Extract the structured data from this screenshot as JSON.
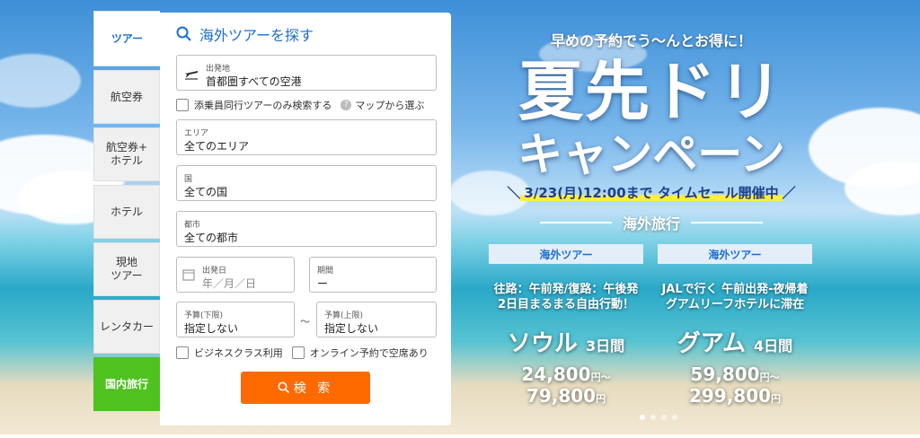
{
  "tabs": [
    {
      "label": "ツアー",
      "active": true
    },
    {
      "label": "航空券"
    },
    {
      "label": "航空券+\nホテル"
    },
    {
      "label": "ホテル"
    },
    {
      "label": "現地\nツアー"
    },
    {
      "label": "レンタカー"
    },
    {
      "label": "国内旅行",
      "domestic": true
    }
  ],
  "search": {
    "title": "海外ツアーを探す",
    "departure": {
      "label": "出発地",
      "value": "首都圏すべての空港"
    },
    "escort_only": "添乗員同行ツアーのみ検索する",
    "map_select": "マップから選ぶ",
    "area": {
      "label": "エリア",
      "value": "全てのエリア"
    },
    "country": {
      "label": "国",
      "value": "全ての国"
    },
    "city": {
      "label": "都市",
      "value": "全ての都市"
    },
    "departure_date": {
      "label": "出発日",
      "placeholder": "年／月／日"
    },
    "duration": {
      "label": "期間",
      "value": "ー"
    },
    "budget_min": {
      "label": "予算(下限)",
      "value": "指定しない"
    },
    "range_sep": "～",
    "budget_max": {
      "label": "予算(上限)",
      "value": "指定しない"
    },
    "business_class": "ビジネスクラス利用",
    "online_available": "オンライン予約で空席あり",
    "button": "検 索",
    "accent": "#1a6fd0",
    "button_color": "#ff6a00"
  },
  "banner": {
    "lead": "早めの予約でう～んとお得に！",
    "title1": "夏先ドリ",
    "title2": "キャンペーン",
    "sale": "3/23(月)12:00まで タイムセール開催中",
    "section": "海外旅行",
    "deals": [
      {
        "chip": "海外ツアー",
        "desc": "往路：午前発/復路：午後発\n2日目まるまる自由行動！",
        "dest": "ソウル",
        "days": "3日間",
        "price_from": "24,800",
        "price_to": "79,800",
        "unit": "円"
      },
      {
        "chip": "海外ツアー",
        "desc": "JALで行く 午前出発-夜帰着\nグアムリーフホテルに滞在",
        "dest": "グアム",
        "days": "4日間",
        "price_from": "59,800",
        "price_to": "299,800",
        "unit": "円"
      }
    ],
    "tilde": "～",
    "slides": 4,
    "active_slide": 0
  }
}
